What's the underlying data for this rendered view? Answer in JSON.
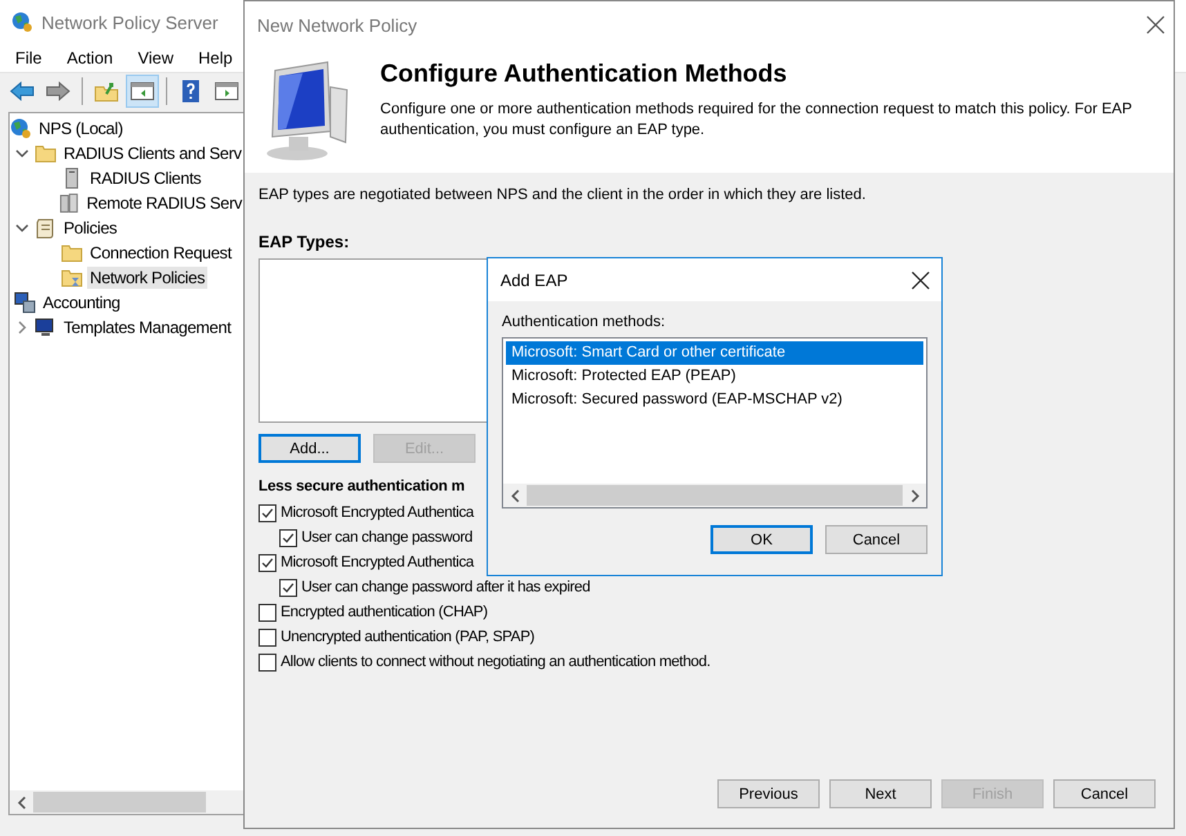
{
  "main_window": {
    "title": "Network Policy Server",
    "menu": [
      "File",
      "Action",
      "View",
      "Help"
    ],
    "toolbar": [
      {
        "kind": "back",
        "pressed": false
      },
      {
        "kind": "forward",
        "pressed": false
      },
      {
        "kind": "separator"
      },
      {
        "kind": "up",
        "pressed": false
      },
      {
        "kind": "tree-toggle",
        "pressed": true
      },
      {
        "kind": "separator"
      },
      {
        "kind": "help",
        "pressed": false
      },
      {
        "kind": "action-pane",
        "pressed": false
      }
    ],
    "tree": [
      {
        "label": "NPS (Local)",
        "kind": "globe",
        "selected": false,
        "children": [
          {
            "label": "RADIUS Clients and Serv",
            "kind": "folder",
            "expanded": true,
            "selected": false,
            "children": [
              {
                "label": "RADIUS Clients",
                "kind": "server",
                "selected": false
              },
              {
                "label": "Remote RADIUS Serv",
                "kind": "servers",
                "selected": false
              }
            ]
          },
          {
            "label": "Policies",
            "kind": "scroll",
            "expanded": true,
            "selected": false,
            "children": [
              {
                "label": "Connection Request",
                "kind": "folder",
                "selected": false
              },
              {
                "label": "Network Policies",
                "kind": "policy-folder",
                "selected": true
              }
            ]
          },
          {
            "label": "Accounting",
            "kind": "accounting",
            "selected": false
          },
          {
            "label": "Templates Management",
            "kind": "templates",
            "expanded": false,
            "selected": false
          }
        ]
      }
    ]
  },
  "wizard": {
    "title": "New Network Policy",
    "heading": "Configure Authentication Methods",
    "description": "Configure one or more authentication methods required for the connection request to match this policy. For EAP authentication, you must configure an EAP type.",
    "intro": "EAP types are negotiated between NPS and the client in the order in which they are listed.",
    "eap_types_label": "EAP Types:",
    "list_buttons": [
      {
        "label": "Add...",
        "default": true,
        "disabled": false
      },
      {
        "label": "Edit...",
        "default": false,
        "disabled": true
      }
    ],
    "less_secure": {
      "label": "Less secure authentication m",
      "options": [
        {
          "label": "Microsoft Encrypted Authentica",
          "checked": true,
          "children": [
            {
              "label": "User can change password",
              "checked": true
            }
          ]
        },
        {
          "label": "Microsoft Encrypted Authentica",
          "checked": true,
          "children": [
            {
              "label": "User can change password after it has expired",
              "checked": true
            }
          ]
        },
        {
          "label": "Encrypted authentication (CHAP)",
          "checked": false
        },
        {
          "label": "Unencrypted authentication (PAP, SPAP)",
          "checked": false
        },
        {
          "label": "Allow clients to connect without negotiating an authentication method.",
          "checked": false
        }
      ]
    },
    "nav_buttons": [
      {
        "label": "Previous",
        "disabled": false
      },
      {
        "label": "Next",
        "disabled": false
      },
      {
        "label": "Finish",
        "disabled": true
      },
      {
        "label": "Cancel",
        "disabled": false
      }
    ]
  },
  "dialog": {
    "title": "Add EAP",
    "label": "Authentication methods:",
    "methods": [
      {
        "label": "Microsoft: Smart Card or other certificate",
        "selected": true
      },
      {
        "label": "Microsoft: Protected EAP (PEAP)",
        "selected": false
      },
      {
        "label": "Microsoft: Secured password (EAP-MSCHAP v2)",
        "selected": false
      }
    ],
    "buttons": [
      {
        "label": "OK",
        "default": true
      },
      {
        "label": "Cancel",
        "default": false
      }
    ]
  }
}
